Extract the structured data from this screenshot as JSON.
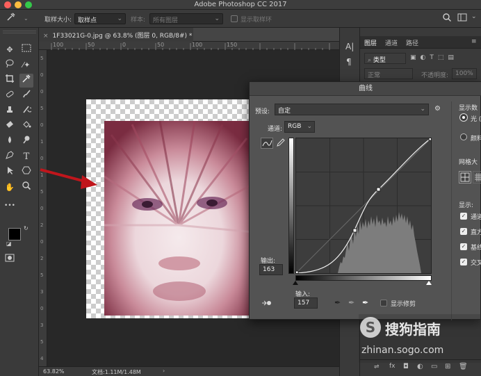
{
  "app": {
    "title": "Adobe Photoshop CC 2017"
  },
  "options_bar": {
    "sample_size_label": "取样大小:",
    "sample_size_value": "取样点",
    "sample_label": "样本:",
    "sample_value": "所有图层",
    "show_ring_label": "显示取样环"
  },
  "document": {
    "tab_title": "1F33021G-0.jpg @ 63.8% (图层 0, RGB/8#) *",
    "ruler_ticks": [
      "100",
      "50",
      "0",
      "50",
      "100",
      "150"
    ],
    "vertical_ruler_ticks": [
      "5",
      "0",
      "0",
      "5",
      "0",
      "1",
      "0",
      "1",
      "5",
      "0",
      "2",
      "0",
      "2",
      "5",
      "3",
      "0",
      "3",
      "5",
      "4"
    ]
  },
  "status_bar": {
    "zoom": "63.82%",
    "doc_size": "文档:1.11M/1.48M"
  },
  "layers_panel": {
    "tabs": [
      "图层",
      "通道",
      "路径"
    ],
    "filter_label": "类型",
    "blend_mode": "正常",
    "opacity_label": "不透明度:",
    "opacity_value": "100%"
  },
  "curves_dialog": {
    "title": "曲线",
    "preset_label": "预设:",
    "preset_value": "自定",
    "channel_label": "通道:",
    "channel_value": "RGB",
    "output_label": "输出:",
    "output_value": "163",
    "input_label": "输入:",
    "input_value": "157",
    "show_clipping_label": "显示修剪",
    "display_amount_label": "显示数",
    "light_label": "光 (",
    "pigment_label": "颜料",
    "grid_size_label": "网格大",
    "show_label": "显示:",
    "options": [
      "通道",
      "直方",
      "基线",
      "交叉"
    ]
  },
  "watermark": {
    "brand": "搜狗指南",
    "url": "zhinan.sogo.com"
  },
  "colors": {
    "arrow": "#c0161c",
    "accent": "#1473e6"
  }
}
